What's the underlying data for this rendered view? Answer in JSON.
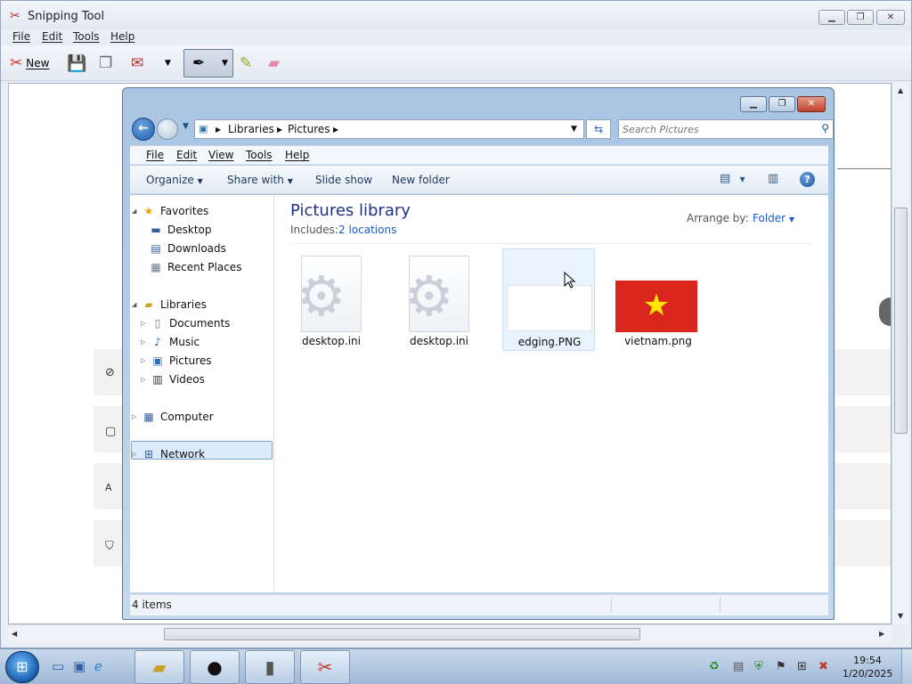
{
  "snipping_tool": {
    "title": "Snipping Tool",
    "menu": [
      "File",
      "Edit",
      "Tools",
      "Help"
    ],
    "toolbar": {
      "new_label": "New"
    }
  },
  "explorer": {
    "address": {
      "crumbs": [
        "Libraries",
        "Pictures"
      ]
    },
    "search": {
      "placeholder": "Search Pictures"
    },
    "menu": [
      "File",
      "Edit",
      "View",
      "Tools",
      "Help"
    ],
    "commands": [
      "Organize",
      "Share with",
      "Slide show",
      "New folder"
    ],
    "nav": {
      "favorites": "Favorites",
      "desktop": "Desktop",
      "downloads": "Downloads",
      "recent": "Recent Places",
      "libraries": "Libraries",
      "documents": "Documents",
      "music": "Music",
      "pictures": "Pictures",
      "videos": "Videos",
      "computer": "Computer",
      "network": "Network"
    },
    "library": {
      "title": "Pictures library",
      "includes_label": "Includes:",
      "locations": "2 locations",
      "arrange_label": "Arrange by:",
      "arrange_value": "Folder"
    },
    "files": [
      {
        "name": "desktop.ini"
      },
      {
        "name": "desktop.ini"
      },
      {
        "name": "edging.PNG"
      },
      {
        "name": "vietnam.png"
      }
    ],
    "status": "4 items"
  },
  "taskbar": {
    "time": "19:54",
    "date": "1/20/2025"
  },
  "colors": {
    "library_title": "#1e3287",
    "link": "#1a5ccf",
    "flag_red": "#da251d",
    "flag_star": "#ffe600"
  }
}
